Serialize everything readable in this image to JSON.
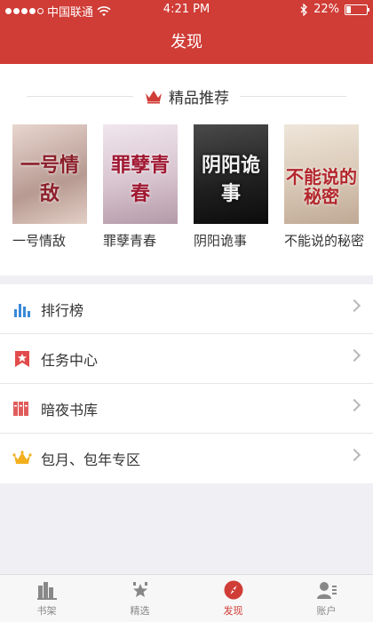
{
  "status": {
    "carrier": "中国联通",
    "time": "4:21 PM",
    "battery": "22%",
    "battery_level": 0.22
  },
  "header": {
    "title": "发现"
  },
  "recommend": {
    "title": "精品推荐",
    "books": [
      {
        "title": "一号情敌",
        "cover_text": "一号情敌"
      },
      {
        "title": "罪孽青春",
        "cover_text": "罪孽青春"
      },
      {
        "title": "阴阳诡事",
        "cover_text": "阴阳诡事"
      },
      {
        "title": "不能说的秘密",
        "cover_text": "不能说的秘密"
      }
    ]
  },
  "menu": [
    {
      "label": "排行榜",
      "icon": "bar-chart-icon"
    },
    {
      "label": "任务中心",
      "icon": "bookmark-star-icon"
    },
    {
      "label": "暗夜书库",
      "icon": "books-icon"
    },
    {
      "label": "包月、包年专区",
      "icon": "crown-icon"
    }
  ],
  "tabs": [
    {
      "label": "书架",
      "icon": "bookshelf-icon",
      "active": false
    },
    {
      "label": "精选",
      "icon": "star-badge-icon",
      "active": false
    },
    {
      "label": "发现",
      "icon": "compass-icon",
      "active": true
    },
    {
      "label": "账户",
      "icon": "user-icon",
      "active": false
    }
  ],
  "colors": {
    "brand": "#d03c36",
    "background": "#efeff4"
  }
}
